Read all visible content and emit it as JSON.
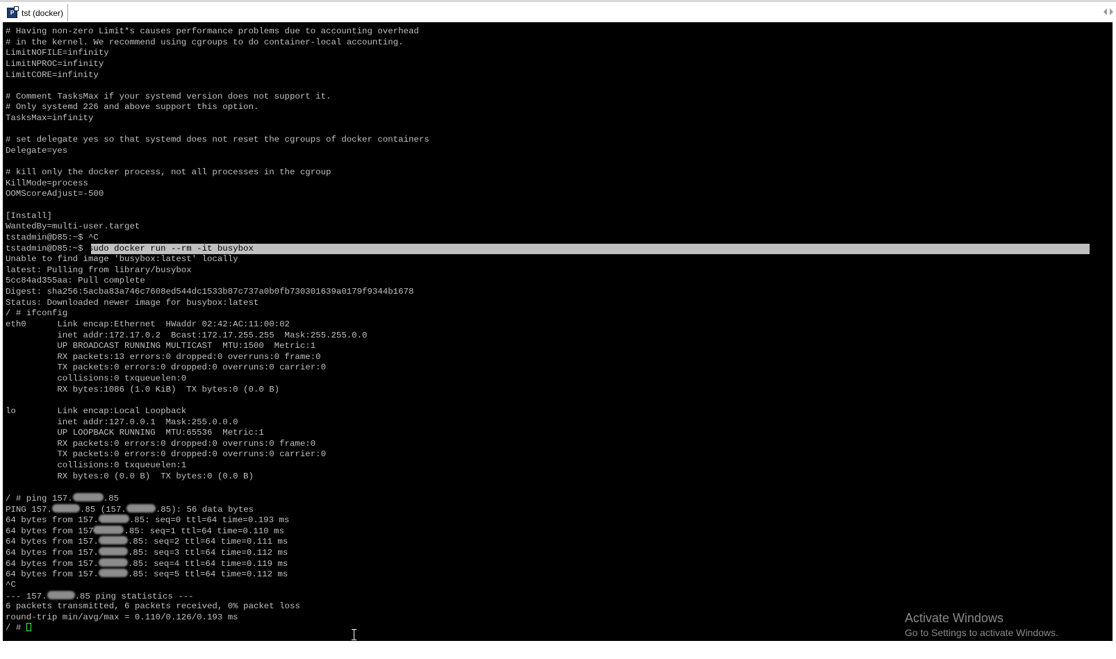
{
  "tab": {
    "title": "tst (docker)",
    "icon": "putty-terminal-icon"
  },
  "terminal": {
    "lines": [
      "# Having non-zero Limit*s causes performance problems due to accounting overhead",
      "# in the kernel. We recommend using cgroups to do container-local accounting.",
      "LimitNOFILE=infinity",
      "LimitNPROC=infinity",
      "LimitCORE=infinity",
      "",
      "# Comment TasksMax if your systemd version does not support it.",
      "# Only systemd 226 and above support this option.",
      "TasksMax=infinity",
      "",
      "# set delegate yes so that systemd does not reset the cgroups of docker containers",
      "Delegate=yes",
      "",
      "# kill only the docker process, not all processes in the cgroup",
      "KillMode=process",
      "OOMScoreAdjust=-500",
      "",
      "[Install]",
      "WantedBy=multi-user.target",
      "tstadmin@D85:~$ ^C"
    ],
    "selected_prompt": "tstadmin@D85:~$",
    "selected_command": " sudo docker run --rm -it busybox",
    "lines2": [
      "Unable to find image 'busybox:latest' locally",
      "latest: Pulling from library/busybox",
      "5cc84ad355aa: Pull complete",
      "Digest: sha256:5acba83a746c7608ed544dc1533b87c737a0b0fb730301639a0179f9344b1678",
      "Status: Downloaded newer image for busybox:latest",
      "/ # ifconfig",
      "eth0      Link encap:Ethernet  HWaddr 02:42:AC:11:00:02",
      "          inet addr:172.17.0.2  Bcast:172.17.255.255  Mask:255.255.0.0",
      "          UP BROADCAST RUNNING MULTICAST  MTU:1500  Metric:1",
      "          RX packets:13 errors:0 dropped:0 overruns:0 frame:0",
      "          TX packets:0 errors:0 dropped:0 overruns:0 carrier:0",
      "          collisions:0 txqueuelen:0",
      "          RX bytes:1086 (1.0 KiB)  TX bytes:0 (0.0 B)",
      "",
      "lo        Link encap:Local Loopback",
      "          inet addr:127.0.0.1  Mask:255.0.0.0",
      "          UP LOOPBACK RUNNING  MTU:65536  Metric:1",
      "          RX packets:0 errors:0 dropped:0 overruns:0 frame:0",
      "          TX packets:0 errors:0 dropped:0 overruns:0 carrier:0",
      "          collisions:0 txqueuelen:1",
      "          RX bytes:0 (0.0 B)  TX bytes:0 (0.0 B)",
      ""
    ],
    "ping_cmd": {
      "pre": "/ # ping 157.",
      "post": ".85"
    },
    "ping_header": {
      "a": "PING 157.",
      "b": ".85 (157.",
      "c": ".85): 56 data bytes"
    },
    "ping_replies": [
      {
        "pre": "64 bytes from 157.",
        "post": ".85: seq=0 ttl=64 time=0.193 ms"
      },
      {
        "pre": "64 bytes from 157",
        "post": ".85: seq=1 ttl=64 time=0.110 ms"
      },
      {
        "pre": "64 bytes from 157.",
        "post": ".85: seq=2 ttl=64 time=0.111 ms"
      },
      {
        "pre": "64 bytes from 157.",
        "post": ".85: seq=3 ttl=64 time=0.112 ms"
      },
      {
        "pre": "64 bytes from 157.",
        "post": ".85: seq=4 ttl=64 time=0.119 ms"
      },
      {
        "pre": "64 bytes from 157.",
        "post": ".85: seq=5 ttl=64 time=0.112 ms"
      }
    ],
    "interrupt": "^C",
    "stats_header": {
      "pre": "--- 157.",
      "post": ".85 ping statistics ---"
    },
    "stats_lines": [
      "6 packets transmitted, 6 packets received, 0% packet loss",
      "round-trip min/avg/max = 0.110/0.126/0.193 ms"
    ],
    "final_prompt": "/ # "
  },
  "watermark": {
    "title": "Activate Windows",
    "subtitle": "Go to Settings to activate Windows."
  },
  "colors": {
    "background": "#000000",
    "foreground": "#c0c0c0",
    "selection": "#c0c0c0",
    "cursor": "#3cff3c"
  }
}
